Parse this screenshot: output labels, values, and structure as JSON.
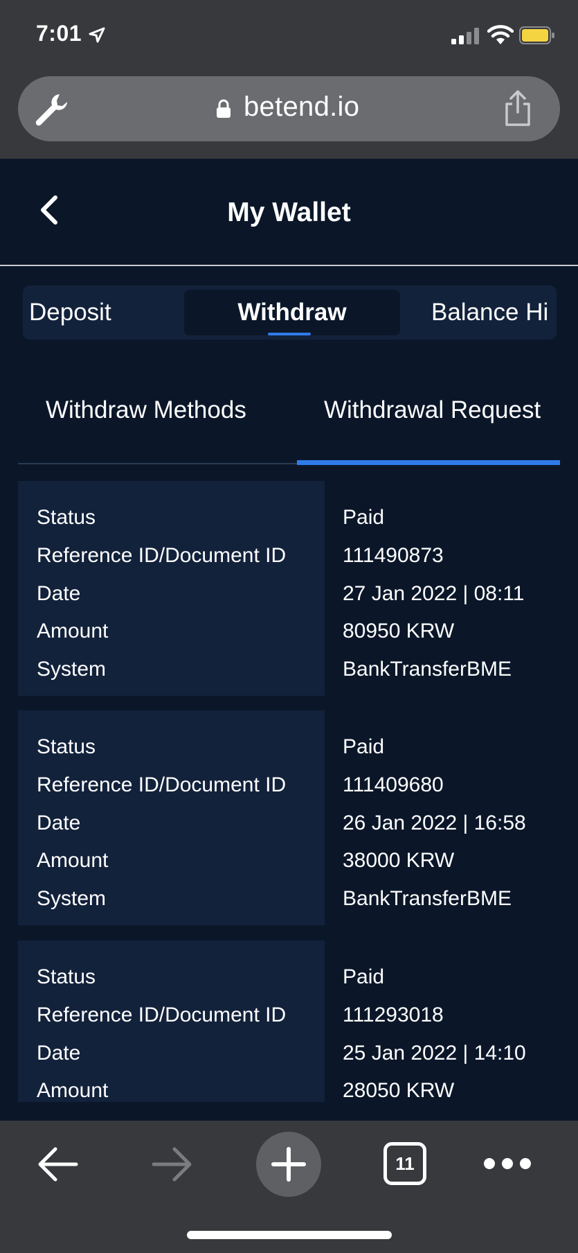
{
  "status_bar": {
    "time": "7:01"
  },
  "browser": {
    "url": "betend.io",
    "tab_count": "11",
    "icons": [
      "wrench-icon",
      "lock-icon",
      "share-icon",
      "back-arrow-icon",
      "forward-arrow-icon",
      "plus-icon",
      "tabs-icon",
      "more-icon"
    ]
  },
  "header": {
    "title": "My Wallet"
  },
  "wallet_tabs": {
    "deposit": "Deposit",
    "withdraw": "Withdraw",
    "balance": "Balance Hi"
  },
  "sub_tabs": {
    "methods": "Withdraw Methods",
    "requests": "Withdrawal Request"
  },
  "labels": {
    "status": "Status",
    "reference": "Reference ID/Document ID",
    "date": "Date",
    "amount": "Amount",
    "system": "System"
  },
  "transactions": [
    {
      "status": "Paid",
      "reference": "111490873",
      "date": "27 Jan 2022 | 08:11",
      "amount": "80950 KRW",
      "system": "BankTransferBME"
    },
    {
      "status": "Paid",
      "reference": "111409680",
      "date": "26 Jan 2022 | 16:58",
      "amount": "38000 KRW",
      "system": "BankTransferBME"
    },
    {
      "status": "Paid",
      "reference": "111293018",
      "date": "25 Jan 2022 | 14:10",
      "amount": "28050 KRW"
    }
  ],
  "colors": {
    "accent": "#2f7bea",
    "page_bg": "#0b1729",
    "panel_bg": "#13223b",
    "browser_chrome": "#38393c"
  }
}
